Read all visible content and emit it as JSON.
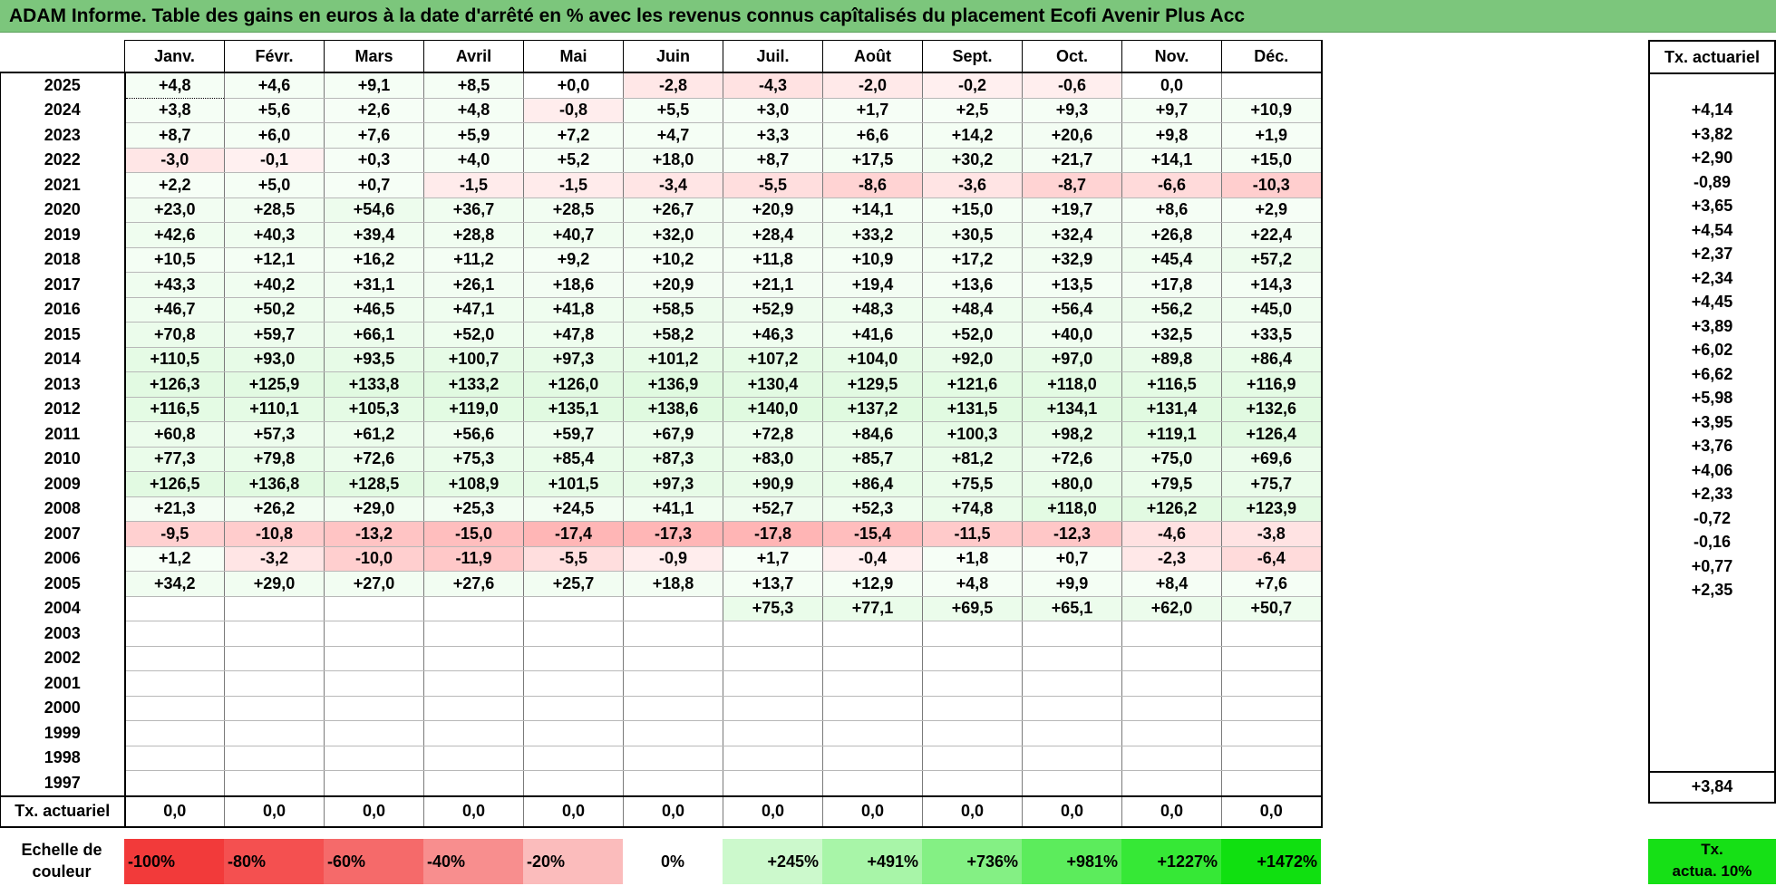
{
  "title": "ADAM Informe. Table des gains en euros à la date d'arrêté en % avec les revenus connus capîtalisés du placement Ecofi Avenir Plus Acc",
  "months": [
    "Janv.",
    "Févr.",
    "Mars",
    "Avril",
    "Mai",
    "Juin",
    "Juil.",
    "Août",
    "Sept.",
    "Oct.",
    "Nov.",
    "Déc."
  ],
  "rate_header": "Tx. actuariel",
  "rows": [
    {
      "year": "2025",
      "values": [
        "+4,8",
        "+4,6",
        "+9,1",
        "+8,5",
        "+0,0",
        "-2,8",
        "-4,3",
        "-2,0",
        "-0,2",
        "-0,6",
        "0,0",
        ""
      ],
      "rate": ""
    },
    {
      "year": "2024",
      "values": [
        "+3,8",
        "+5,6",
        "+2,6",
        "+4,8",
        "-0,8",
        "+5,5",
        "+3,0",
        "+1,7",
        "+2,5",
        "+9,3",
        "+9,7",
        "+10,9"
      ],
      "rate": "+4,14"
    },
    {
      "year": "2023",
      "values": [
        "+8,7",
        "+6,0",
        "+7,6",
        "+5,9",
        "+7,2",
        "+4,7",
        "+3,3",
        "+6,6",
        "+14,2",
        "+20,6",
        "+9,8",
        "+1,9"
      ],
      "rate": "+3,82"
    },
    {
      "year": "2022",
      "values": [
        "-3,0",
        "-0,1",
        "+0,3",
        "+4,0",
        "+5,2",
        "+18,0",
        "+8,7",
        "+17,5",
        "+30,2",
        "+21,7",
        "+14,1",
        "+15,0"
      ],
      "rate": "+2,90"
    },
    {
      "year": "2021",
      "values": [
        "+2,2",
        "+5,0",
        "+0,7",
        "-1,5",
        "-1,5",
        "-3,4",
        "-5,5",
        "-8,6",
        "-3,6",
        "-8,7",
        "-6,6",
        "-10,3"
      ],
      "rate": "-0,89"
    },
    {
      "year": "2020",
      "values": [
        "+23,0",
        "+28,5",
        "+54,6",
        "+36,7",
        "+28,5",
        "+26,7",
        "+20,9",
        "+14,1",
        "+15,0",
        "+19,7",
        "+8,6",
        "+2,9"
      ],
      "rate": "+3,65"
    },
    {
      "year": "2019",
      "values": [
        "+42,6",
        "+40,3",
        "+39,4",
        "+28,8",
        "+40,7",
        "+32,0",
        "+28,4",
        "+33,2",
        "+30,5",
        "+32,4",
        "+26,8",
        "+22,4"
      ],
      "rate": "+4,54"
    },
    {
      "year": "2018",
      "values": [
        "+10,5",
        "+12,1",
        "+16,2",
        "+11,2",
        "+9,2",
        "+10,2",
        "+11,8",
        "+10,9",
        "+17,2",
        "+32,9",
        "+45,4",
        "+57,2"
      ],
      "rate": "+2,37"
    },
    {
      "year": "2017",
      "values": [
        "+43,3",
        "+40,2",
        "+31,1",
        "+26,1",
        "+18,6",
        "+20,9",
        "+21,1",
        "+19,4",
        "+13,6",
        "+13,5",
        "+17,8",
        "+14,3"
      ],
      "rate": "+2,34"
    },
    {
      "year": "2016",
      "values": [
        "+46,7",
        "+50,2",
        "+46,5",
        "+47,1",
        "+41,8",
        "+58,5",
        "+52,9",
        "+48,3",
        "+48,4",
        "+56,4",
        "+56,2",
        "+45,0"
      ],
      "rate": "+4,45"
    },
    {
      "year": "2015",
      "values": [
        "+70,8",
        "+59,7",
        "+66,1",
        "+52,0",
        "+47,8",
        "+58,2",
        "+46,3",
        "+41,6",
        "+52,0",
        "+40,0",
        "+32,5",
        "+33,5"
      ],
      "rate": "+3,89"
    },
    {
      "year": "2014",
      "values": [
        "+110,5",
        "+93,0",
        "+93,5",
        "+100,7",
        "+97,3",
        "+101,2",
        "+107,2",
        "+104,0",
        "+92,0",
        "+97,0",
        "+89,8",
        "+86,4"
      ],
      "rate": "+6,02"
    },
    {
      "year": "2013",
      "values": [
        "+126,3",
        "+125,9",
        "+133,8",
        "+133,2",
        "+126,0",
        "+136,9",
        "+130,4",
        "+129,5",
        "+121,6",
        "+118,0",
        "+116,5",
        "+116,9"
      ],
      "rate": "+6,62"
    },
    {
      "year": "2012",
      "values": [
        "+116,5",
        "+110,1",
        "+105,3",
        "+119,0",
        "+135,1",
        "+138,6",
        "+140,0",
        "+137,2",
        "+131,5",
        "+134,1",
        "+131,4",
        "+132,6"
      ],
      "rate": "+5,98"
    },
    {
      "year": "2011",
      "values": [
        "+60,8",
        "+57,3",
        "+61,2",
        "+56,6",
        "+59,7",
        "+67,9",
        "+72,8",
        "+84,6",
        "+100,3",
        "+98,2",
        "+119,1",
        "+126,4"
      ],
      "rate": "+3,95"
    },
    {
      "year": "2010",
      "values": [
        "+77,3",
        "+79,8",
        "+72,6",
        "+75,3",
        "+85,4",
        "+87,3",
        "+83,0",
        "+85,7",
        "+81,2",
        "+72,6",
        "+75,0",
        "+69,6"
      ],
      "rate": "+3,76"
    },
    {
      "year": "2009",
      "values": [
        "+126,5",
        "+136,8",
        "+128,5",
        "+108,9",
        "+101,5",
        "+97,3",
        "+90,9",
        "+86,4",
        "+75,5",
        "+80,0",
        "+79,5",
        "+75,7"
      ],
      "rate": "+4,06"
    },
    {
      "year": "2008",
      "values": [
        "+21,3",
        "+26,2",
        "+29,0",
        "+25,3",
        "+24,5",
        "+41,1",
        "+52,7",
        "+52,3",
        "+74,8",
        "+118,0",
        "+126,2",
        "+123,9"
      ],
      "rate": "+2,33"
    },
    {
      "year": "2007",
      "values": [
        "-9,5",
        "-10,8",
        "-13,2",
        "-15,0",
        "-17,4",
        "-17,3",
        "-17,8",
        "-15,4",
        "-11,5",
        "-12,3",
        "-4,6",
        "-3,8"
      ],
      "rate": "-0,72"
    },
    {
      "year": "2006",
      "values": [
        "+1,2",
        "-3,2",
        "-10,0",
        "-11,9",
        "-5,5",
        "-0,9",
        "+1,7",
        "-0,4",
        "+1,8",
        "+0,7",
        "-2,3",
        "-6,4"
      ],
      "rate": "-0,16"
    },
    {
      "year": "2005",
      "values": [
        "+34,2",
        "+29,0",
        "+27,0",
        "+27,6",
        "+25,7",
        "+18,8",
        "+13,7",
        "+12,9",
        "+4,8",
        "+9,9",
        "+8,4",
        "+7,6"
      ],
      "rate": "+0,77"
    },
    {
      "year": "2004",
      "values": [
        "",
        "",
        "",
        "",
        "",
        "",
        "+75,3",
        "+77,1",
        "+69,5",
        "+65,1",
        "+62,0",
        "+50,7"
      ],
      "rate": "+2,35"
    },
    {
      "year": "2003",
      "values": [
        "",
        "",
        "",
        "",
        "",
        "",
        "",
        "",
        "",
        "",
        "",
        ""
      ],
      "rate": ""
    },
    {
      "year": "2002",
      "values": [
        "",
        "",
        "",
        "",
        "",
        "",
        "",
        "",
        "",
        "",
        "",
        ""
      ],
      "rate": ""
    },
    {
      "year": "2001",
      "values": [
        "",
        "",
        "",
        "",
        "",
        "",
        "",
        "",
        "",
        "",
        "",
        ""
      ],
      "rate": ""
    },
    {
      "year": "2000",
      "values": [
        "",
        "",
        "",
        "",
        "",
        "",
        "",
        "",
        "",
        "",
        "",
        ""
      ],
      "rate": ""
    },
    {
      "year": "1999",
      "values": [
        "",
        "",
        "",
        "",
        "",
        "",
        "",
        "",
        "",
        "",
        "",
        ""
      ],
      "rate": ""
    },
    {
      "year": "1998",
      "values": [
        "",
        "",
        "",
        "",
        "",
        "",
        "",
        "",
        "",
        "",
        "",
        ""
      ],
      "rate": ""
    },
    {
      "year": "1997",
      "values": [
        "",
        "",
        "",
        "",
        "",
        "",
        "",
        "",
        "",
        "",
        "",
        ""
      ],
      "rate": ""
    }
  ],
  "summary": {
    "label": "Tx. actuariel",
    "values": [
      "0,0",
      "0,0",
      "0,0",
      "0,0",
      "0,0",
      "0,0",
      "0,0",
      "0,0",
      "0,0",
      "0,0",
      "0,0",
      "0,0"
    ],
    "rate": "+3,84"
  },
  "legend": {
    "label_line1": "Echelle de",
    "label_line2": "couleur",
    "swatches": [
      {
        "label": "-100%",
        "color": "#f23a3a",
        "kind": "neg"
      },
      {
        "label": "-80%",
        "color": "#f45050",
        "kind": "neg"
      },
      {
        "label": "-60%",
        "color": "#f56a6a",
        "kind": "neg"
      },
      {
        "label": "-40%",
        "color": "#f88e8e",
        "kind": "neg"
      },
      {
        "label": "-20%",
        "color": "#fbbcbc",
        "kind": "neg"
      },
      {
        "label": "0%",
        "color": "#ffffff",
        "kind": "zero"
      },
      {
        "label": "+245%",
        "color": "#ccf9cc",
        "kind": "pos"
      },
      {
        "label": "+491%",
        "color": "#a8f5a8",
        "kind": "pos"
      },
      {
        "label": "+736%",
        "color": "#84f084",
        "kind": "pos"
      },
      {
        "label": "+981%",
        "color": "#5cec5c",
        "kind": "pos"
      },
      {
        "label": "+1227%",
        "color": "#36e836",
        "kind": "pos"
      },
      {
        "label": "+1472%",
        "color": "#10e010",
        "kind": "pos"
      }
    ],
    "rate_line1": "Tx.",
    "rate_line2": "actua. 10%",
    "rate_color": "#16e016"
  }
}
